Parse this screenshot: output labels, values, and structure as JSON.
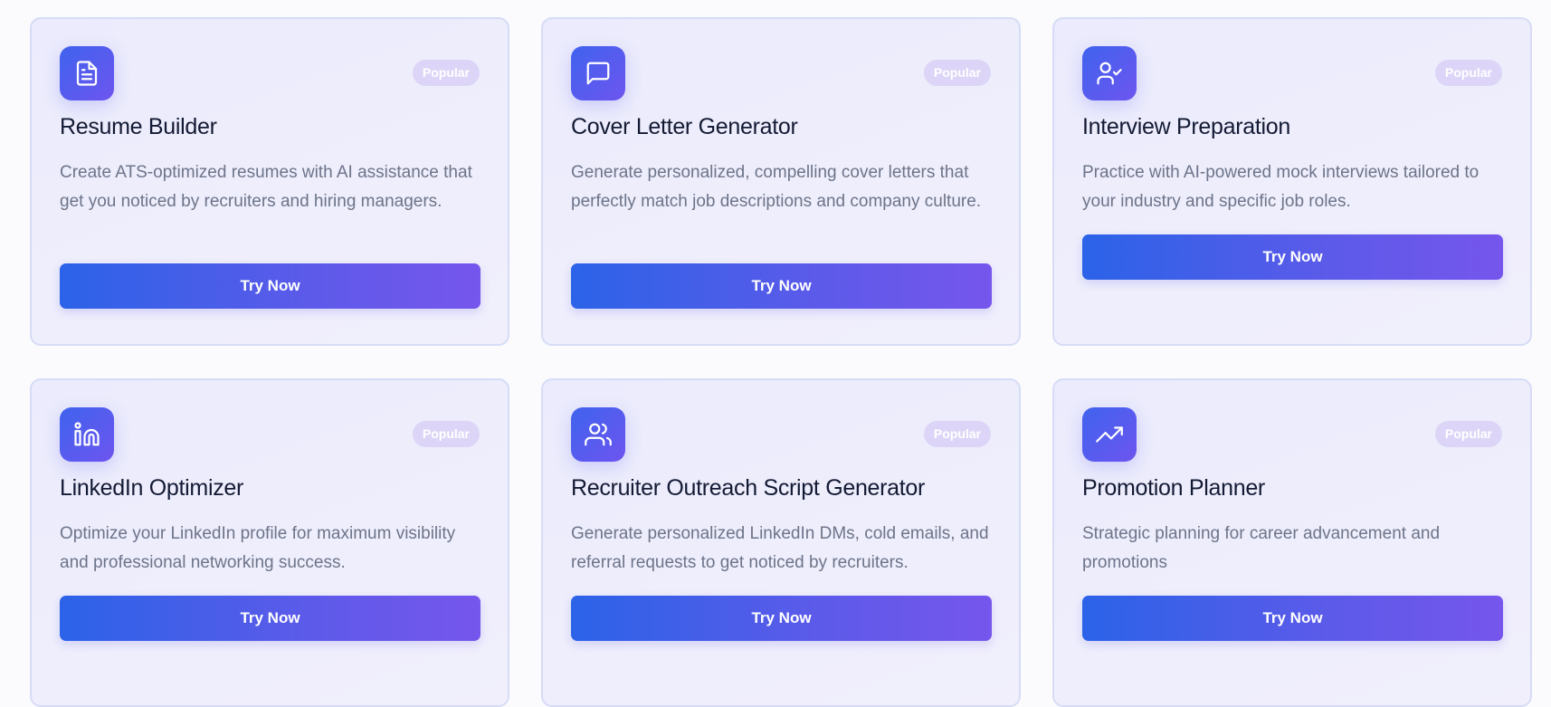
{
  "colors": {
    "accent_start": "#2b63e8",
    "accent_end": "#7656ec",
    "card_border": "#d6dcf5",
    "badge_bg": "#dcd5f7"
  },
  "cards": [
    {
      "icon": "document-icon",
      "badge": "Popular",
      "title": "Resume Builder",
      "description": "Create ATS-optimized resumes with AI assistance that get you noticed by recruiters and hiring managers.",
      "button": "Try Now"
    },
    {
      "icon": "chat-bubble-icon",
      "badge": "Popular",
      "title": "Cover Letter Generator",
      "description": "Generate personalized, compelling cover letters that perfectly match job descriptions and company culture.",
      "button": "Try Now"
    },
    {
      "icon": "user-check-icon",
      "badge": "Popular",
      "title": "Interview Preparation",
      "description": "Practice with AI-powered mock interviews tailored to your industry and specific job roles.",
      "button": "Try Now"
    },
    {
      "icon": "linkedin-icon",
      "badge": "Popular",
      "title": "LinkedIn Optimizer",
      "description": "Optimize your LinkedIn profile for maximum visibility and professional networking success.",
      "button": "Try Now"
    },
    {
      "icon": "users-icon",
      "badge": "Popular",
      "title": "Recruiter Outreach Script Generator",
      "description": "Generate personalized LinkedIn DMs, cold emails, and referral requests to get noticed by recruiters.",
      "button": "Try Now"
    },
    {
      "icon": "trending-up-icon",
      "badge": "Popular",
      "title": "Promotion Planner",
      "description": "Strategic planning for career advancement and promotions",
      "button": "Try Now"
    }
  ]
}
